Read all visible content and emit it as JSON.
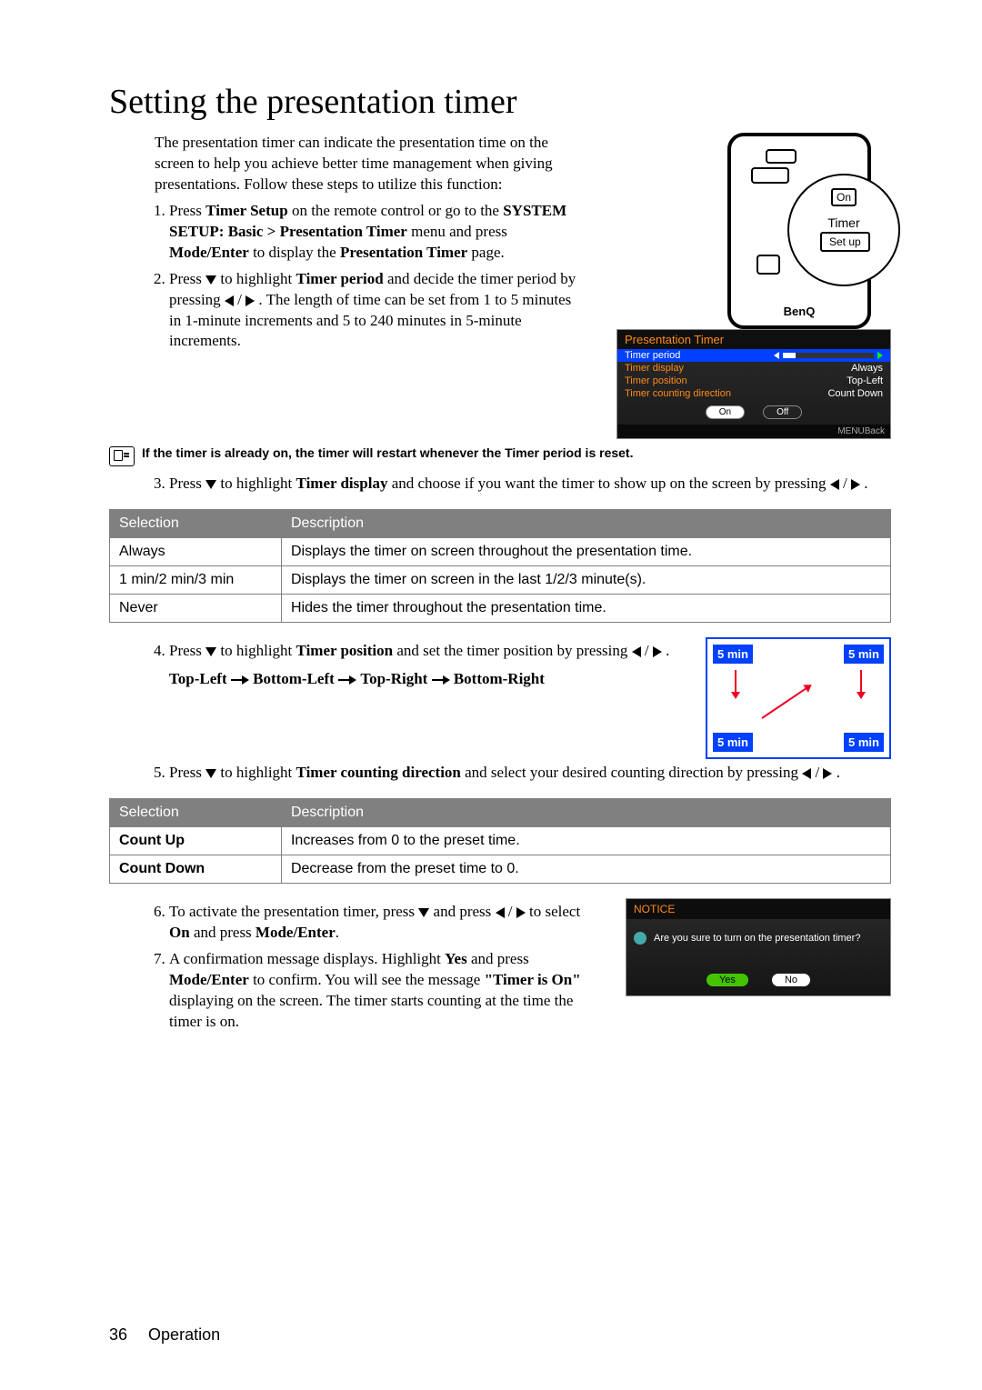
{
  "title": "Setting the presentation timer",
  "intro": "The presentation timer can indicate the presentation time on the screen to help you achieve better time management when giving presentations. Follow these steps to utilize this function:",
  "steps": {
    "s1a": "Press ",
    "s1b": "Timer Setup",
    "s1c": " on the remote control or go to the ",
    "s1d": "SYSTEM SETUP: Basic > Presentation Timer",
    "s1e": " menu and press ",
    "s1f": "Mode/Enter",
    "s1g": " to display the ",
    "s1h": "Presentation Timer",
    "s1i": " page.",
    "s2a": "Press ",
    "s2b": " to highlight ",
    "s2c": "Timer period",
    "s2d": " and decide the timer period by pressing ",
    "s2e": " . The length of time can be set from 1 to 5 minutes in 1-minute increments and 5 to 240 minutes in 5-minute increments.",
    "s3a": "Press ",
    "s3b": " to highlight ",
    "s3c": "Timer display",
    "s3d": " and choose if you want the timer to show up on the screen by pressing ",
    "s3e": " .",
    "s4a": "Press ",
    "s4b": " to highlight ",
    "s4c": "Timer position",
    "s4d": " and set the timer position by pressing ",
    "s4e": " .",
    "s4_path_1": "Top-Left",
    "s4_path_2": "Bottom-Left",
    "s4_path_3": "Top-Right",
    "s4_path_4": "Bottom-Right",
    "s5a": "Press ",
    "s5b": " to highlight ",
    "s5c": "Timer counting direction",
    "s5d": " and select your desired counting direction by pressing ",
    "s5e": " .",
    "s6a": "To activate the presentation timer, press ",
    "s6b": " and press ",
    "s6c": " to select ",
    "s6d": "On",
    "s6e": " and press ",
    "s6f": "Mode/Enter",
    "s6g": ".",
    "s7a": "A confirmation message displays. Highlight ",
    "s7b": "Yes",
    "s7c": " and press ",
    "s7d": "Mode/Enter",
    "s7e": " to confirm. You will see the  message ",
    "s7f": "\"Timer is On\"",
    "s7g": " displaying on the screen. The timer starts counting at the time the timer is on."
  },
  "note": "If the timer is already on, the timer will restart whenever the Timer period is reset.",
  "table1": {
    "headers": [
      "Selection",
      "Description"
    ],
    "rows": [
      [
        "Always",
        "Displays the timer on screen throughout the presentation time."
      ],
      [
        "1 min/2 min/3 min",
        "Displays the timer on screen in the last 1/2/3 minute(s)."
      ],
      [
        "Never",
        "Hides the timer throughout the presentation time."
      ]
    ]
  },
  "table2": {
    "headers": [
      "Selection",
      "Description"
    ],
    "rows": [
      [
        "Count Up",
        "Increases from 0 to the preset time."
      ],
      [
        "Count Down",
        "Decrease from the preset time to 0."
      ]
    ]
  },
  "remote": {
    "on": "On",
    "timer": "Timer",
    "setup": "Set up",
    "brand": "BenQ"
  },
  "osd": {
    "title": "Presentation Timer",
    "rows": [
      {
        "l": "Timer period",
        "r": ""
      },
      {
        "l": "Timer display",
        "r": "Always"
      },
      {
        "l": "Timer position",
        "r": "Top-Left"
      },
      {
        "l": "Timer counting direction",
        "r": "Count Down"
      }
    ],
    "btn_on": "On",
    "btn_off": "Off",
    "foot": "MENUBack"
  },
  "posfig": {
    "label": "5 min"
  },
  "notice": {
    "title": "NOTICE",
    "msg": "Are you sure to turn on the presentation timer?",
    "yes": "Yes",
    "no": "No"
  },
  "footer": {
    "page": "36",
    "section": "Operation"
  }
}
